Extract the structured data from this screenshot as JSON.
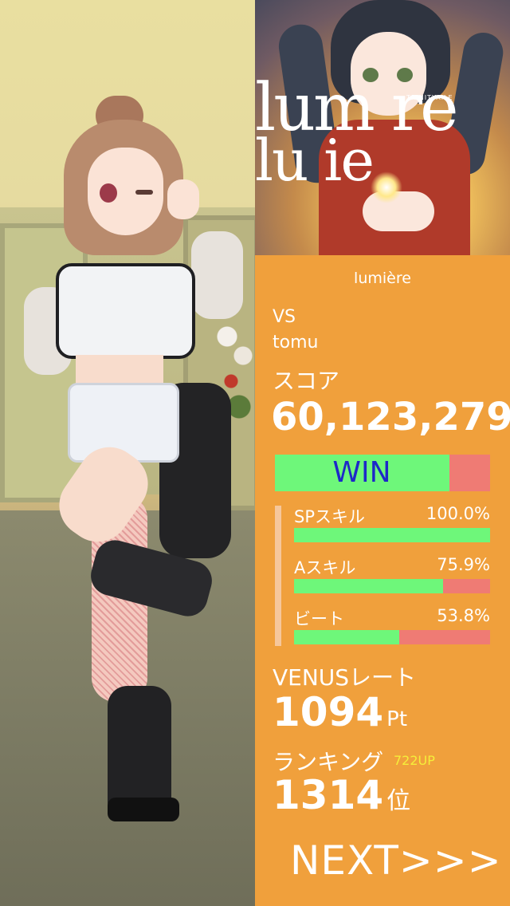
{
  "album": {
    "title_line1": "lum re",
    "title_line2": "lu ie",
    "artist_small": "TRINITYAiLE",
    "colors": {
      "title": "#ffffff"
    }
  },
  "result": {
    "song_title": "lumière",
    "vs_label": "VS",
    "opponent": "tomu",
    "score_label": "スコア",
    "score": "60,123,279",
    "outcome": "WIN",
    "outcome_fill": 0.81,
    "skills": [
      {
        "name": "SPスキル",
        "percent_text": "100.0%",
        "value": 100.0
      },
      {
        "name": "Aスキル",
        "percent_text": "75.9%",
        "value": 75.9
      },
      {
        "name": "ビート",
        "percent_text": "53.8%",
        "value": 53.8
      }
    ],
    "rate_label": "VENUSレート",
    "rate_value": "1094",
    "rate_unit": "Pt",
    "ranking_label": "ランキング",
    "ranking_up": "722UP",
    "ranking_value": "1314",
    "ranking_unit": "位",
    "next_label": "NEXT>>>"
  },
  "colors": {
    "panel_bg": "#f0a03c",
    "bar_green": "#6ef77a",
    "bar_red": "#ef7b74",
    "win_text": "#1d28c9",
    "rank_up_text": "#f5ee3a"
  }
}
